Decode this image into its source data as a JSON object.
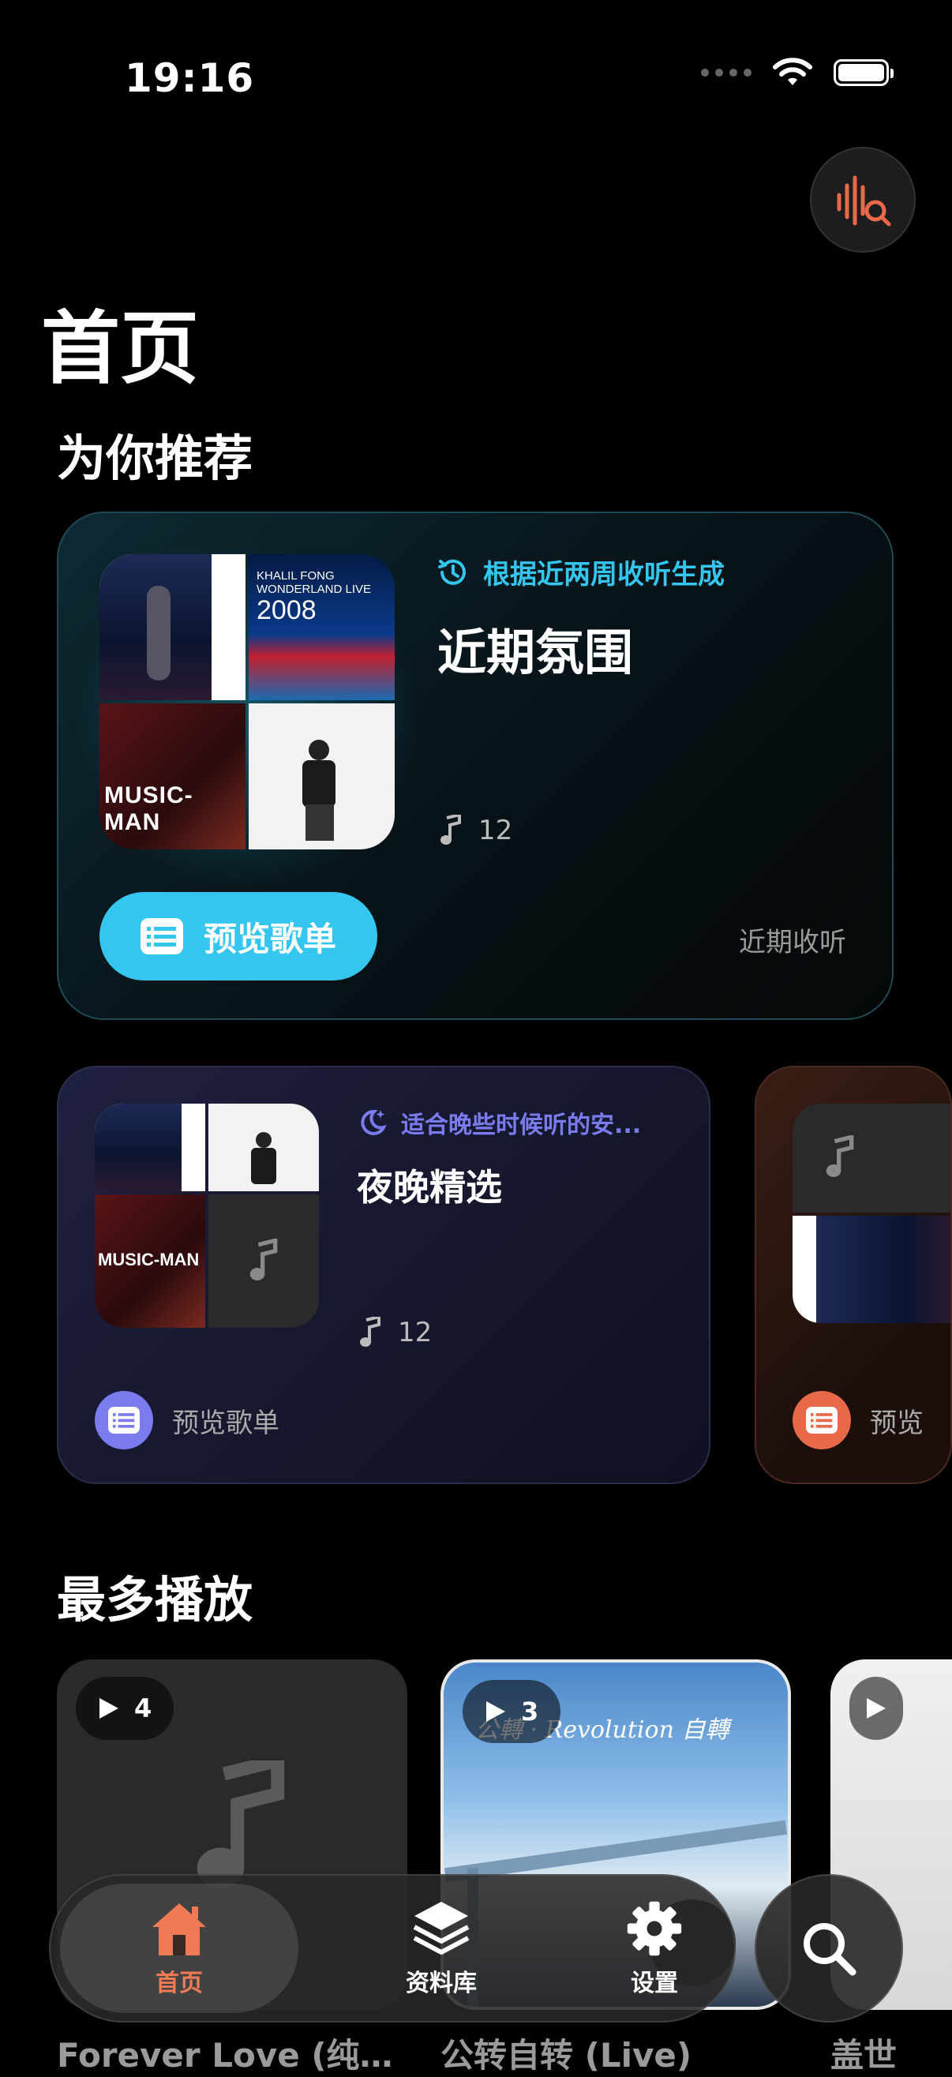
{
  "status_bar": {
    "time": "19:16"
  },
  "header": {
    "title": "首页"
  },
  "recommend": {
    "section_title": "为你推荐",
    "featured": {
      "tag": "根据近两周收听生成",
      "title": "近期氛围",
      "track_count": "12",
      "preview_label": "预览歌单",
      "source_label": "近期收听",
      "accent": "#35c6ef"
    },
    "night": {
      "tag": "适合晚些时候听的安...",
      "title": "夜晚精选",
      "track_count": "12",
      "preview_label": "预览歌单",
      "accent": "#7b7bf0"
    },
    "partial": {
      "preview_label": "预览",
      "accent": "#e8684a"
    }
  },
  "most_played": {
    "section_title": "最多播放",
    "items": [
      {
        "play_count": "4",
        "title": "Forever Love (纯…"
      },
      {
        "play_count": "3",
        "title": "公转自转 (Live)"
      },
      {
        "play_count": "",
        "title": "盖世"
      }
    ]
  },
  "tab_bar": {
    "tabs": [
      {
        "label": "首页",
        "icon": "house-icon",
        "active": true
      },
      {
        "label": "资料库",
        "icon": "stack-icon",
        "active": false
      },
      {
        "label": "设置",
        "icon": "gear-icon",
        "active": false
      }
    ],
    "active_color": "#f07a55"
  }
}
